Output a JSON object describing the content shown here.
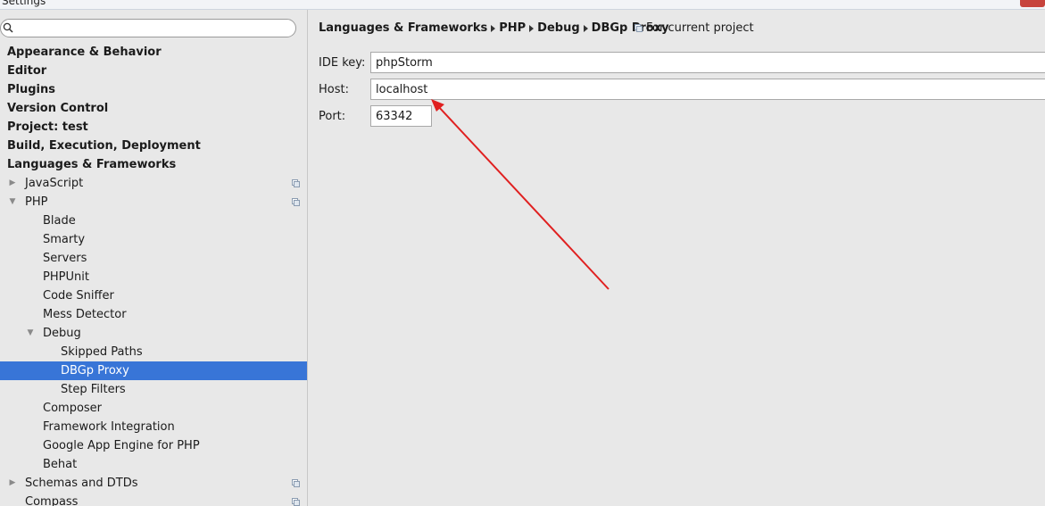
{
  "window": {
    "title": "Settings"
  },
  "search": {
    "placeholder": "",
    "value": ""
  },
  "sidebar": {
    "items": [
      {
        "label": "Appearance & Behavior"
      },
      {
        "label": "Editor"
      },
      {
        "label": "Plugins"
      },
      {
        "label": "Version Control"
      },
      {
        "label": "Project: test"
      },
      {
        "label": "Build, Execution, Deployment"
      },
      {
        "label": "Languages & Frameworks"
      },
      {
        "label": "JavaScript"
      },
      {
        "label": "PHP"
      },
      {
        "label": "Blade"
      },
      {
        "label": "Smarty"
      },
      {
        "label": "Servers"
      },
      {
        "label": "PHPUnit"
      },
      {
        "label": "Code Sniffer"
      },
      {
        "label": "Mess Detector"
      },
      {
        "label": "Debug"
      },
      {
        "label": "Skipped Paths"
      },
      {
        "label": "DBGp Proxy"
      },
      {
        "label": "Step Filters"
      },
      {
        "label": "Composer"
      },
      {
        "label": "Framework Integration"
      },
      {
        "label": "Google App Engine for PHP"
      },
      {
        "label": "Behat"
      },
      {
        "label": "Schemas and DTDs"
      },
      {
        "label": "Compass"
      }
    ]
  },
  "breadcrumb": {
    "parts": [
      "Languages & Frameworks",
      "PHP",
      "Debug",
      "DBGp Proxy"
    ],
    "scope_label": "For current project"
  },
  "form": {
    "ide_key": {
      "label": "IDE key:",
      "value": "phpStorm"
    },
    "host": {
      "label": "Host:",
      "value": "localhost"
    },
    "port": {
      "label": "Port:",
      "value": "63342"
    }
  },
  "colors": {
    "selection": "#3875d7",
    "annotation_arrow": "#e02020"
  }
}
